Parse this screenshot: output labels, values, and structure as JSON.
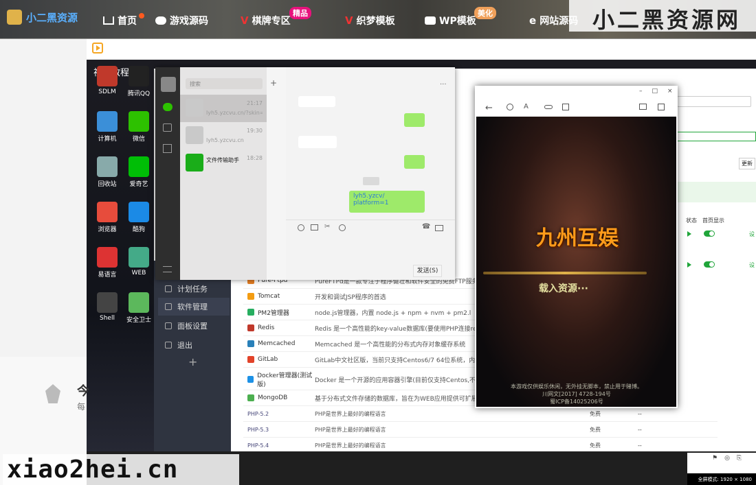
{
  "site": {
    "brand": "小二黑资源",
    "nav": [
      {
        "label": "首页"
      },
      {
        "label": "游戏源码"
      },
      {
        "label": "棋牌专区",
        "badge": "精品"
      },
      {
        "label": "织梦模板"
      },
      {
        "label": "WP模板",
        "badge": "美化"
      },
      {
        "label": "网站源码"
      }
    ],
    "watermark_top": "小二黑资源网",
    "watermark_bottom": "xiao2hei.cn"
  },
  "player": {
    "title": "视频教程"
  },
  "desktop": {
    "icons": [
      {
        "label": "SDLM",
        "color": "#c0392b"
      },
      {
        "label": "腾讯QQ",
        "color": "#222"
      },
      {
        "label": "计算机",
        "color": "#3b8fd8"
      },
      {
        "label": "微信",
        "color": "#2dc100"
      },
      {
        "label": "回收站",
        "color": "#8aa"
      },
      {
        "label": "爱奇艺",
        "color": "#00be06"
      },
      {
        "label": "浏览器",
        "color": "#e74c3c"
      },
      {
        "label": "酷狗",
        "color": "#1b8ae6"
      },
      {
        "label": "易语言",
        "color": "#d33"
      },
      {
        "label": "WEB",
        "color": "#4a8"
      },
      {
        "label": "Shell",
        "color": "#444"
      },
      {
        "label": "安全卫士",
        "color": "#5cb85c"
      }
    ]
  },
  "chat": {
    "search_placeholder": "搜索",
    "conversations": [
      {
        "preview": "lyh5.yzcvu.cn/?skin=0&p...",
        "time": "21:17"
      },
      {
        "preview": "lyh5.yzcvu.cn",
        "time": "19:30"
      },
      {
        "name": "文件传输助手",
        "time": "18:28"
      }
    ],
    "msg_green": "lyh5.yzcv/ platform=1",
    "send_label": "发送(S)"
  },
  "admin": {
    "sidebar": [
      {
        "label": "计划任务"
      },
      {
        "label": "软件管理",
        "active": true
      },
      {
        "label": "面板设置"
      },
      {
        "label": "退出"
      }
    ],
    "plus": "+",
    "update_label": "更新",
    "header_cols": [
      "状态",
      "首页显示"
    ],
    "software": [
      {
        "name": "Pure-Ftpd",
        "desc": "PureFTPd是一款专注于程序健壮和软件安全的免费FTP服务器软件",
        "color": "#e67e22"
      },
      {
        "name": "Tomcat",
        "desc": "开发和调试JSP程序的首选",
        "color": "#f39c12"
      },
      {
        "name": "PM2管理器",
        "desc": "node.js管理器，内置 node.js + npm + nvm + pm2.l",
        "color": "#27ae60"
      },
      {
        "name": "Redis",
        "desc": "Redis 是一个高性能的key-value数据库(要使用PHP连接redis，需在PH",
        "color": "#c0392b"
      },
      {
        "name": "Memcached",
        "desc": "Memcached 是一个高性能的分布式内存对象缓存系统",
        "color": "#2980b9"
      },
      {
        "name": "GitLab",
        "desc": "GitLab中文社区版，当前只支持Centos6/7 64位系统，内存小于2GB的",
        "color": "#e24329"
      },
      {
        "name": "Docker管理器(测试版)",
        "desc": "Docker 是一个开源的应用容器引擎(目前仅支持Centos,不支持OpenV",
        "color": "#1d91e6"
      },
      {
        "name": "MongoDB",
        "desc": "基于分布式文件存储的数据库，旨在为WEB应用提供可扩展的高性能数",
        "color": "#4caf50"
      }
    ],
    "php_rows": [
      {
        "name": "PHP-5.2",
        "desc": "PHP是世界上最好的编程语言",
        "price": "免费",
        "dash": "--"
      },
      {
        "name": "PHP-5.3",
        "desc": "PHP是世界上最好的编程语言",
        "price": "免费",
        "dash": "--"
      },
      {
        "name": "PHP-5.4",
        "desc": "PHP是世界上最好的编程语言",
        "price": "免费",
        "dash": "--"
      }
    ],
    "side_links": [
      "设",
      "设"
    ]
  },
  "game": {
    "logo": "九州互娱",
    "loading": "载入资源···",
    "footer1": "本游戏仅供娱乐休闲，无外挂无脚本，禁止用于赌博。",
    "footer2": "川网文[2017] 4728-194号",
    "footer3": "蜀ICP备14025206号"
  },
  "left_page": {
    "title": "今",
    "sub": "每"
  },
  "status_bar": "全屏模式: 1920 × 1080"
}
